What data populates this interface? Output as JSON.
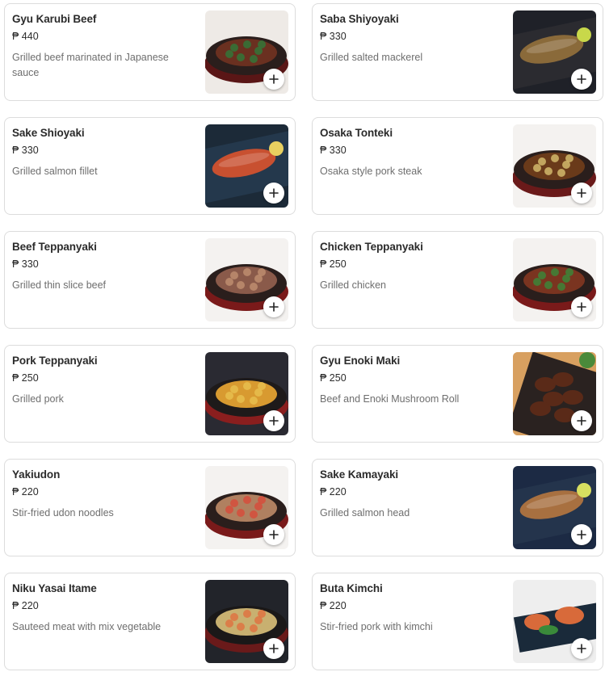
{
  "menu_items": [
    {
      "name": "Gyu Karubi Beef",
      "price": "₱ 440",
      "description": "Grilled beef marinated in Japanese sauce",
      "image": {
        "bg": "#eeeae6",
        "plate": "#2a1e1c",
        "rim": "#5a1616",
        "food": "#6a3020",
        "accent": "#2f7a3a",
        "style": "pan"
      }
    },
    {
      "name": "Saba Shiyoyaki",
      "price": "₱ 330",
      "description": "Grilled salted mackerel",
      "image": {
        "bg": "#1f2128",
        "plate": "#2b2b30",
        "rim": "#3a3a40",
        "food": "#8a6a3a",
        "accent": "#c8d84a",
        "style": "fish"
      }
    },
    {
      "name": "Sake Shioyaki",
      "price": "₱ 330",
      "description": "Grilled salmon fillet",
      "image": {
        "bg": "#1c2a38",
        "plate": "#24384c",
        "rim": "#3a5066",
        "food": "#c85030",
        "accent": "#e8d060",
        "style": "fish"
      }
    },
    {
      "name": "Osaka Tonteki",
      "price": "₱ 330",
      "description": "Osaka style pork steak",
      "image": {
        "bg": "#f4f2f0",
        "plate": "#2a1e1c",
        "rim": "#6a1a1a",
        "food": "#6a3a1a",
        "accent": "#d8c070",
        "style": "pan"
      }
    },
    {
      "name": "Beef Teppanyaki",
      "price": "₱ 330",
      "description": "Grilled thin slice beef",
      "image": {
        "bg": "#f4f2f0",
        "plate": "#2a1e1c",
        "rim": "#7a1a1a",
        "food": "#8a5a4a",
        "accent": "#c09070",
        "style": "pan"
      }
    },
    {
      "name": "Chicken Teppanyaki",
      "price": "₱ 250",
      "description": "Grilled chicken",
      "image": {
        "bg": "#f4f2f0",
        "plate": "#2a1e1c",
        "rim": "#7a1a1a",
        "food": "#7a3420",
        "accent": "#3a8a3a",
        "style": "pan"
      }
    },
    {
      "name": "Pork Teppanyaki",
      "price": "₱ 250",
      "description": "Grilled pork",
      "image": {
        "bg": "#2a2a32",
        "plate": "#1e1a1a",
        "rim": "#8a1e1e",
        "food": "#d89a30",
        "accent": "#e8c050",
        "style": "pan"
      }
    },
    {
      "name": "Gyu Enoki Maki",
      "price": "₱ 250",
      "description": "Beef and Enoki Mushroom Roll",
      "image": {
        "bg": "#d8a060",
        "plate": "#2a2220",
        "rim": "#3a2e28",
        "food": "#5a2a18",
        "accent": "#4a8a3a",
        "style": "rolls"
      }
    },
    {
      "name": "Yakiudon",
      "price": "₱ 220",
      "description": "Stir-fried udon noodles",
      "image": {
        "bg": "#f4f2f0",
        "plate": "#2a1e1c",
        "rim": "#7a1a1a",
        "food": "#b08060",
        "accent": "#d84a3a",
        "style": "pan"
      }
    },
    {
      "name": "Sake Kamayaki",
      "price": "₱ 220",
      "description": "Grilled salmon head",
      "image": {
        "bg": "#1c2a44",
        "plate": "#24344c",
        "rim": "#3a4a66",
        "food": "#a87040",
        "accent": "#d8e060",
        "style": "fish"
      }
    },
    {
      "name": "Niku Yasai Itame",
      "price": "₱ 220",
      "description": "Sauteed meat with mix vegetable",
      "image": {
        "bg": "#22242a",
        "plate": "#1a1818",
        "rim": "#6a1a1a",
        "food": "#c8b070",
        "accent": "#e07040",
        "style": "pan"
      }
    },
    {
      "name": "Buta Kimchi",
      "price": "₱ 220",
      "description": "Stir-fried pork with kimchi",
      "image": {
        "bg": "#eeeeee",
        "plate": "#1a2a3a",
        "rim": "#2a3a4a",
        "food": "#d86a3a",
        "accent": "#3a8a3a",
        "style": "tray"
      }
    }
  ],
  "add_button_icon": "plus-icon"
}
